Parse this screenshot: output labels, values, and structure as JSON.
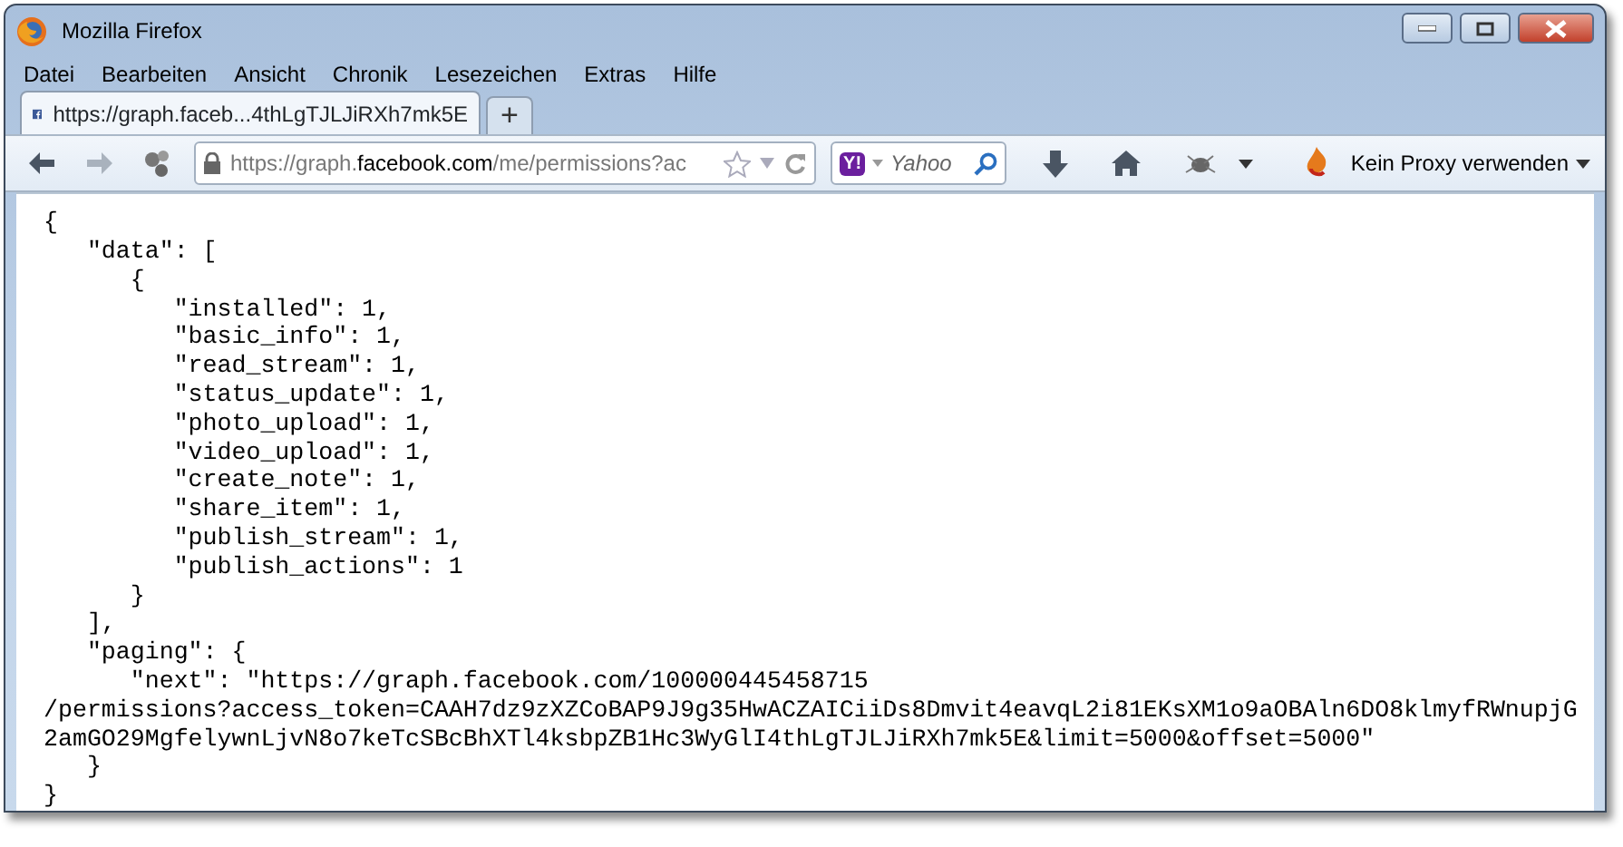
{
  "window": {
    "title": "Mozilla Firefox"
  },
  "menu": [
    "Datei",
    "Bearbeiten",
    "Ansicht",
    "Chronik",
    "Lesezeichen",
    "Extras",
    "Hilfe"
  ],
  "tabs": [
    {
      "label": "https://graph.faceb...4thLgTJLJiRXh7mk5E",
      "selected": true
    }
  ],
  "new_tab": "+",
  "url_bar": {
    "prefix": "https://graph.",
    "domain": "facebook.com",
    "path": "/me/permissions?ac"
  },
  "search": {
    "engine": "Y!",
    "placeholder": "Yahoo"
  },
  "proxy": {
    "label": "Kein Proxy verwenden"
  },
  "content": [
    "{",
    "   \"data\": [",
    "      {",
    "         \"installed\": 1,",
    "         \"basic_info\": 1,",
    "         \"read_stream\": 1,",
    "         \"status_update\": 1,",
    "         \"photo_upload\": 1,",
    "         \"video_upload\": 1,",
    "         \"create_note\": 1,",
    "         \"share_item\": 1,",
    "         \"publish_stream\": 1,",
    "         \"publish_actions\": 1",
    "      }",
    "   ],",
    "   \"paging\": {",
    "      \"next\": \"https://graph.facebook.com/100000445458715",
    "/permissions?access_token=CAAH7dz9zXZCoBAP9J9g35HwACZAICiiDs8Dmvit4eavqL2i81EKsXM1o9aOBAln6DO8klmyfRWnupjG",
    "2amGO29MgfelywnLjvN8o7keTcSBcBhXTl4ksbpZB1Hc3WyGlI4thLgTJLJiRXh7mk5E&limit=5000&offset=5000\"",
    "   }",
    "}"
  ]
}
